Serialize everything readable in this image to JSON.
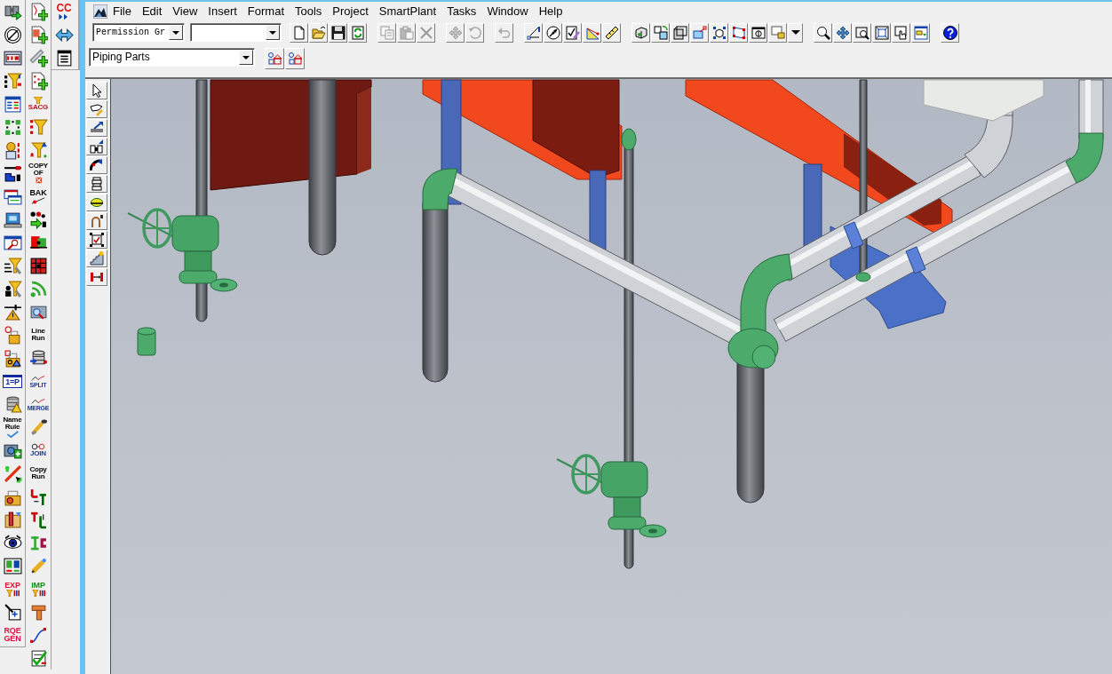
{
  "left_dock": {
    "column_1": [
      {
        "kind": "icon"
      },
      {
        "kind": "icon"
      },
      {
        "kind": "icon"
      },
      {
        "kind": "icon"
      },
      {
        "kind": "icon"
      },
      {
        "kind": "icon"
      },
      {
        "kind": "icon"
      },
      {
        "kind": "icon"
      },
      {
        "kind": "icon"
      },
      {
        "kind": "icon"
      },
      {
        "kind": "icon"
      },
      {
        "kind": "icon"
      },
      {
        "kind": "icon"
      },
      {
        "kind": "icon"
      },
      {
        "kind": "icon"
      },
      {
        "kind": "icon"
      },
      {
        "kind": "label",
        "label": "1=P"
      },
      {
        "kind": "icon"
      },
      {
        "kind": "label",
        "label": "Name Rule"
      },
      {
        "kind": "icon"
      },
      {
        "kind": "icon"
      },
      {
        "kind": "icon"
      },
      {
        "kind": "icon"
      },
      {
        "kind": "icon"
      },
      {
        "kind": "icon"
      },
      {
        "kind": "label",
        "label": "EXP"
      },
      {
        "kind": "icon"
      },
      {
        "kind": "label",
        "label": "RQE GEN"
      }
    ],
    "column_2": [
      {
        "kind": "icon"
      },
      {
        "kind": "icon"
      },
      {
        "kind": "icon"
      },
      {
        "kind": "icon"
      },
      {
        "kind": "caption",
        "label": "SACG"
      },
      {
        "kind": "icon"
      },
      {
        "kind": "icon"
      },
      {
        "kind": "label",
        "label": "COPY OF"
      },
      {
        "kind": "label",
        "label": "BAK"
      },
      {
        "kind": "icon"
      },
      {
        "kind": "icon"
      },
      {
        "kind": "icon"
      },
      {
        "kind": "icon"
      },
      {
        "kind": "icon"
      },
      {
        "kind": "label",
        "label": "Line Run"
      },
      {
        "kind": "icon"
      },
      {
        "kind": "caption",
        "label": "SPLIT"
      },
      {
        "kind": "caption",
        "label": "MERGE"
      },
      {
        "kind": "icon"
      },
      {
        "kind": "caption",
        "label": "JOIN"
      },
      {
        "kind": "label",
        "label": "Copy Run"
      },
      {
        "kind": "icon"
      },
      {
        "kind": "icon"
      },
      {
        "kind": "icon"
      },
      {
        "kind": "icon"
      },
      {
        "kind": "label",
        "label": "IMP"
      },
      {
        "kind": "icon"
      },
      {
        "kind": "icon"
      },
      {
        "kind": "icon"
      }
    ],
    "column_3": [
      {
        "kind": "label",
        "label": "CC"
      },
      {
        "kind": "icon"
      },
      {
        "kind": "icon"
      }
    ]
  },
  "menu": [
    "File",
    "Edit",
    "View",
    "Insert",
    "Format",
    "Tools",
    "Project",
    "SmartPlant",
    "Tasks",
    "Window",
    "Help"
  ],
  "toolbar": {
    "permission_group": "Permission Gr",
    "groups": [
      {
        "buttons": [
          {
            "disabled": false
          },
          {
            "disabled": false
          },
          {
            "disabled": false
          },
          {
            "disabled": false
          }
        ]
      },
      {
        "buttons": [
          {
            "disabled": true
          },
          {
            "disabled": true
          },
          {
            "disabled": true
          }
        ]
      },
      {
        "buttons": [
          {
            "disabled": true
          },
          {
            "disabled": true
          }
        ]
      },
      {
        "buttons": [
          {
            "disabled": true
          }
        ]
      },
      {
        "buttons": [
          {
            "disabled": false
          },
          {
            "disabled": false
          },
          {
            "disabled": false
          },
          {
            "disabled": false
          },
          {
            "disabled": false
          }
        ]
      },
      {
        "buttons": [
          {
            "disabled": false
          },
          {
            "disabled": false
          },
          {
            "disabled": false
          },
          {
            "disabled": false
          },
          {
            "disabled": false
          },
          {
            "disabled": false
          },
          {
            "disabled": false
          },
          {
            "disabled": false
          },
          {
            "disabled": false
          }
        ]
      },
      {
        "buttons": [
          {
            "disabled": false
          },
          {
            "disabled": false
          },
          {
            "disabled": false
          },
          {
            "disabled": false
          },
          {
            "disabled": false
          },
          {
            "disabled": false
          }
        ]
      },
      {
        "buttons": [
          {
            "disabled": false
          }
        ]
      }
    ]
  },
  "filter_bar": {
    "parts_filter": "Piping Parts"
  }
}
